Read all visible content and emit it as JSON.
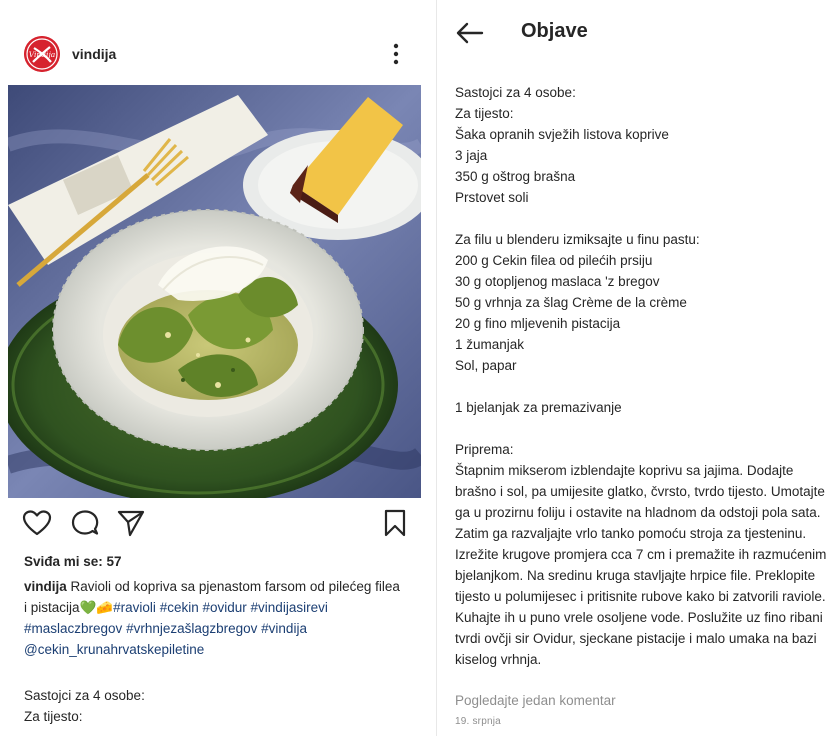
{
  "post": {
    "username": "vindija",
    "avatar_brand_text": "Vindija",
    "likes_text": "Sviđa mi se: 57",
    "caption_user": "vindija",
    "caption_text": " Ravioli od kopriva sa pjenastom farsom od pilećeg filea i pistacija",
    "caption_emoji": "💚🧀",
    "hashtags": [
      "#ravioli",
      "#cekin",
      "#ovidur",
      "#vindijasirevi",
      "#maslaczbregov",
      "#vrhnjezašlagzbregov",
      "#vindija",
      "@cekin_krunahrvatskepiletine"
    ],
    "preview_lines": [
      "Sastojci za 4 osobe:",
      "Za tijesto:"
    ]
  },
  "icons": {
    "like": "heart-icon",
    "comment": "comment-bubble-icon",
    "share": "paper-plane-icon",
    "save": "bookmark-icon",
    "more": "more-vertical-icon",
    "back": "arrow-left-icon"
  },
  "detail": {
    "title": "Objave",
    "recipe_lines": [
      "Sastojci za 4 osobe:",
      "Za tijesto:",
      "Šaka opranih svježih listova koprive",
      "3 jaja",
      "350 g oštrog brašna",
      "Prstovet soli",
      "",
      "Za filu u blenderu izmiksajte u finu pastu:",
      "200 g Cekin filea od pilećih prsiju",
      "30 g otopljenog maslaca 'z bregov",
      "50 g vrhnja za šlag Crème de la crème",
      "20 g fino mljevenih pistacija",
      "1 žumanjak",
      "Sol, papar",
      "",
      "1 bjelanjak za premazivanje",
      "",
      "Priprema:",
      "Štapnim mikserom izblendajte koprivu sa jajima. Dodajte brašno i sol, pa umijesite glatko, čvrsto, tvrdo tijesto. Umotajte ga u prozirnu foliju i ostavite na hladnom da odstoji pola sata.",
      "Zatim ga razvaljajte vrlo tanko pomoću stroja za tjesteninu. Izrežite krugove promjera cca 7 cm i premažite ih razmućenim bjelanjkom. Na sredinu kruga stavljajte hrpice file. Preklopite tijesto u polumijesec i pritisnite rubove kako bi zatvorili raviole. Kuhajte ih u puno vrele osoljene vode. Poslužite uz fino ribani tvrdi ovčji sir Ovidur, sjeckane pistacije i malo umaka na bazi kiselog vrhnja."
    ],
    "comments_link": "Pogledajte jedan komentar",
    "date": "19. srpnja"
  },
  "colors": {
    "brand_red": "#d6232e",
    "hashtag": "#1c3f73",
    "muted": "#8e8e8e",
    "text": "#262626"
  }
}
